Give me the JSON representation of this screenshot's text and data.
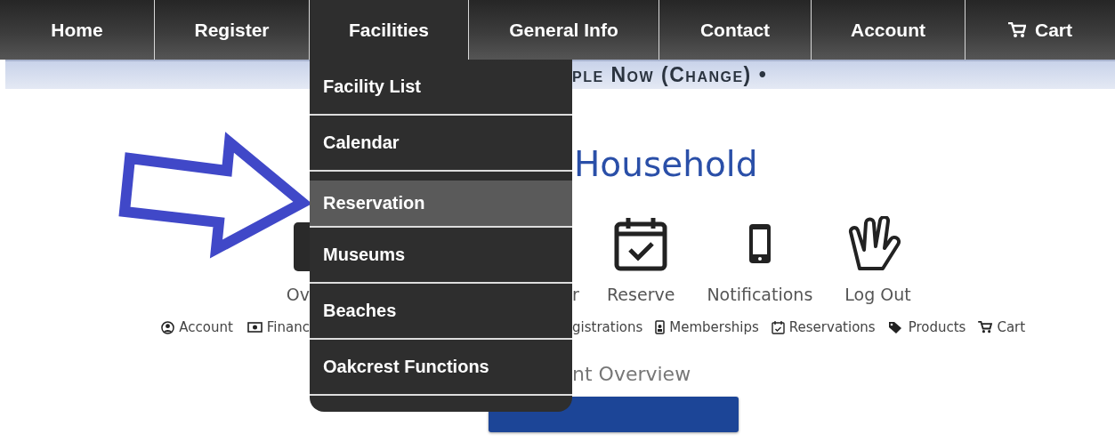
{
  "nav": [
    {
      "label": "Home",
      "kind": "text",
      "selected": false
    },
    {
      "label": "Register",
      "kind": "text",
      "selected": false
    },
    {
      "label": "Facilities",
      "kind": "text",
      "selected": true
    },
    {
      "label": "General Info",
      "kind": "text",
      "selected": false
    },
    {
      "label": "Contact",
      "kind": "text",
      "selected": false
    },
    {
      "label": "Account",
      "kind": "text",
      "selected": false
    },
    {
      "label": "Cart",
      "kind": "cart",
      "selected": false
    }
  ],
  "banner": {
    "text": "ple Now (Change) •"
  },
  "dropdown": [
    {
      "label": "Facility List",
      "selected": false
    },
    {
      "label": "Calendar",
      "selected": false
    },
    {
      "label": "Reservation",
      "selected": true
    },
    {
      "label": "Museums",
      "selected": false
    },
    {
      "label": "Beaches",
      "selected": false
    },
    {
      "label": "Oakcrest Functions",
      "selected": false
    }
  ],
  "heading": "Household",
  "tiles_left": [
    {
      "label": "Ov",
      "kind": "tile"
    }
  ],
  "tiles_right": [
    {
      "label": "r",
      "kind": "none"
    },
    {
      "label": "Reserve",
      "kind": "calendar"
    },
    {
      "label": "Notifications",
      "kind": "phone"
    },
    {
      "label": "Log Out",
      "kind": "hand"
    }
  ],
  "links_left": [
    {
      "label": "Account",
      "kind": "account"
    },
    {
      "label": "Financ",
      "kind": "finance"
    }
  ],
  "links_right": [
    {
      "label": "gistrations",
      "kind": "none"
    },
    {
      "label": "Memberships",
      "kind": "membership"
    },
    {
      "label": "Reservations",
      "kind": "calendar"
    },
    {
      "label": "Products",
      "kind": "tag"
    },
    {
      "label": "Cart",
      "kind": "cart"
    }
  ],
  "subheading": "nt Overview"
}
